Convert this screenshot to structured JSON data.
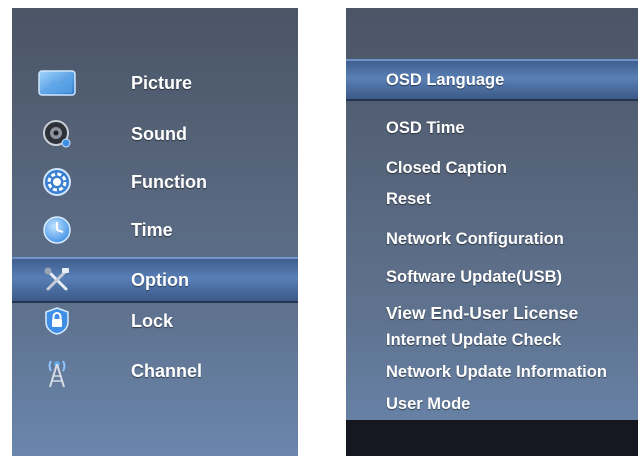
{
  "left_menu": {
    "selected": "Option",
    "items": [
      {
        "label": "Picture",
        "icon": "picture-icon"
      },
      {
        "label": "Sound",
        "icon": "sound-icon"
      },
      {
        "label": "Function",
        "icon": "function-icon"
      },
      {
        "label": "Time",
        "icon": "time-icon"
      },
      {
        "label": "Option",
        "icon": "option-icon"
      },
      {
        "label": "Lock",
        "icon": "lock-icon"
      },
      {
        "label": "Channel",
        "icon": "channel-icon"
      }
    ]
  },
  "option_menu": {
    "selected": "OSD Language",
    "items": [
      {
        "label": "OSD Language"
      },
      {
        "label": "OSD Time"
      },
      {
        "label": "Closed Caption"
      },
      {
        "label": "Reset"
      },
      {
        "label": "Network Configuration"
      },
      {
        "label": "Software Update(USB)"
      },
      {
        "label": "View End-User License"
      },
      {
        "label": "Internet Update Check"
      },
      {
        "label": "Network Update Information"
      },
      {
        "label": "User Mode"
      }
    ]
  },
  "colors": {
    "panel_top": "#4a5566",
    "panel_bottom": "#6a86ad",
    "highlight": "#587fb6",
    "text": "#ffffff"
  }
}
